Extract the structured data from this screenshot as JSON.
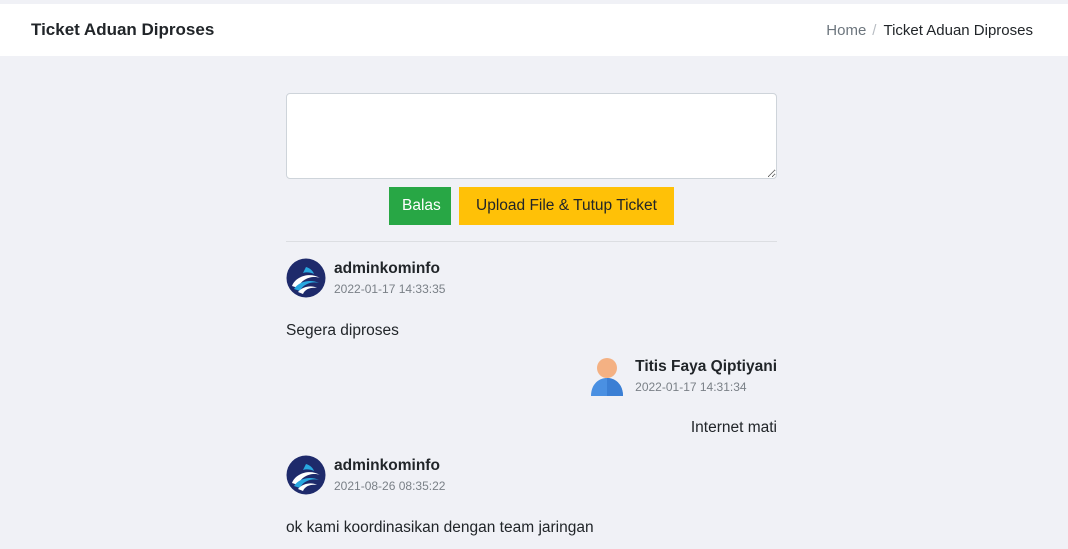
{
  "header": {
    "title": "Ticket Aduan Diproses",
    "breadcrumb": {
      "home": "Home",
      "separator": "/",
      "current": "Ticket Aduan Diproses"
    }
  },
  "reply_form": {
    "textarea_value": "",
    "reply_button": "Balas",
    "upload_close_button": "Upload File & Tutup Ticket"
  },
  "messages": [
    {
      "author": "adminkominfo",
      "timestamp": "2022-01-17 14:33:35",
      "text": "Segera diproses",
      "avatar": "kominfo-logo-icon",
      "align": "left"
    },
    {
      "author": "Titis Faya Qiptiyani",
      "timestamp": "2022-01-17 14:31:34",
      "text": "Internet mati",
      "avatar": "user-icon",
      "align": "right"
    },
    {
      "author": "adminkominfo",
      "timestamp": "2021-08-26 08:35:22",
      "text": "ok kami koordinasikan dengan team jaringan",
      "avatar": "kominfo-logo-icon",
      "align": "left"
    }
  ],
  "colors": {
    "success": "#28a745",
    "warning": "#ffc107",
    "background": "#f0f1f6"
  }
}
